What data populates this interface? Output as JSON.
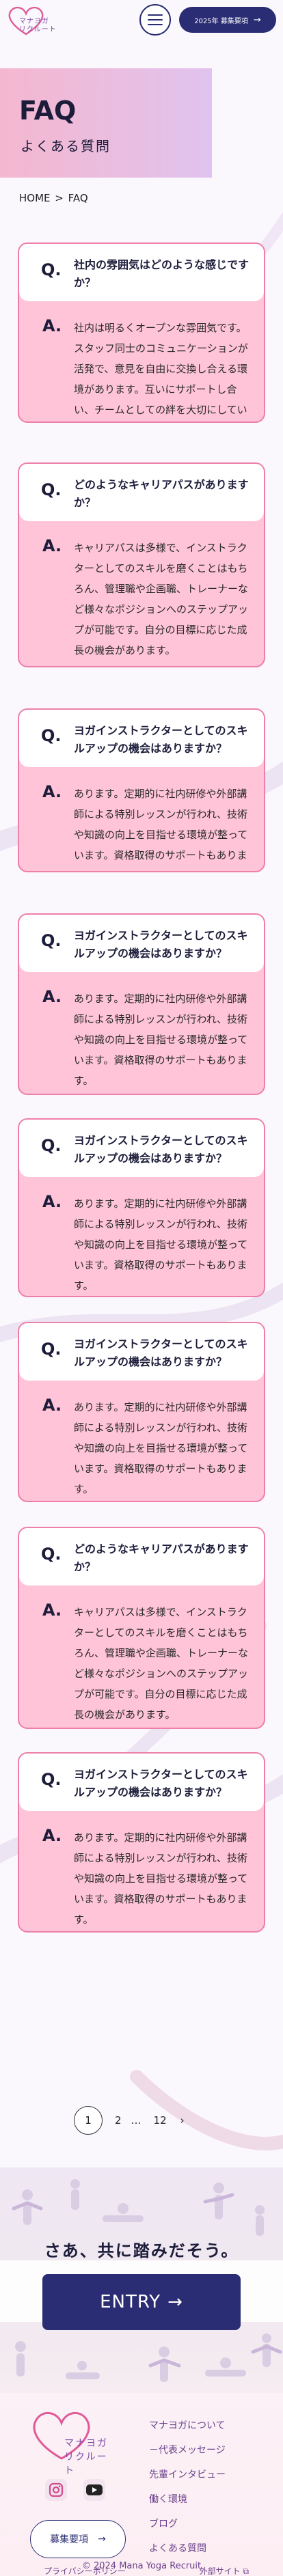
{
  "header": {
    "logo_text_line1": "マナヨガ",
    "logo_text_line2": "リクルート",
    "recruit_button_label": "2025年 募集要項",
    "menu_label": "menu-icon"
  },
  "hero": {
    "title": "FAQ",
    "subtitle": "よくある質問"
  },
  "breadcrumb": {
    "home": "HOME",
    "separator": ">",
    "current": "FAQ"
  },
  "faq": [
    {
      "q_mark": "Q.",
      "question": "社内の雰囲気はどのような感じですか？",
      "a_mark": "A.",
      "answer": "社内は明るくオープンな雰囲気です。スタッフ同士のコミュニケーションが活発で、意見を自由に交換し合える環境があります。互いにサポートし合い、チームとしての絆を大切にしています。"
    },
    {
      "q_mark": "Q.",
      "question": "どのようなキャリアパスがありますか？",
      "a_mark": "A.",
      "answer": "キャリアパスは多様で、インストラクターとしてのスキルを磨くことはもちろん、管理職や企画職、トレーナーなど様々なポジションへのステップアップが可能です。自分の目標に応じた成長の機会があります。"
    },
    {
      "q_mark": "Q.",
      "question": "ヨガインストラクターとしてのスキルアップの機会はありますか？",
      "a_mark": "A.",
      "answer": "あります。定期的に社内研修や外部講師による特別レッスンが行われ、技術や知識の向上を目指せる環境が整っています。資格取得のサポートもあります。"
    },
    {
      "q_mark": "Q.",
      "question": "ヨガインストラクターとしてのスキルアップの機会はありますか？",
      "a_mark": "A.",
      "answer": "あります。定期的に社内研修や外部講師による特別レッスンが行われ、技術や知識の向上を目指せる環境が整っています。資格取得のサポートもあります。"
    },
    {
      "q_mark": "Q.",
      "question": "ヨガインストラクターとしてのスキルアップの機会はありますか？",
      "a_mark": "A.",
      "answer": "あります。定期的に社内研修や外部講師による特別レッスンが行われ、技術や知識の向上を目指せる環境が整っています。資格取得のサポートもあります。"
    },
    {
      "q_mark": "Q.",
      "question": "ヨガインストラクターとしてのスキルアップの機会はありますか？",
      "a_mark": "A.",
      "answer": "あります。定期的に社内研修や外部講師による特別レッスンが行われ、技術や知識の向上を目指せる環境が整っています。資格取得のサポートもあります。"
    },
    {
      "q_mark": "Q.",
      "question": "どのようなキャリアパスがありますか？",
      "a_mark": "A.",
      "answer": "キャリアパスは多様で、インストラクターとしてのスキルを磨くことはもちろん、管理職や企画職、トレーナーなど様々なポジションへのステップアップが可能です。自分の目標に応じた成長の機会があります。"
    },
    {
      "q_mark": "Q.",
      "question": "ヨガインストラクターとしてのスキルアップの機会はありますか？",
      "a_mark": "A.",
      "answer": "あります。定期的に社内研修や外部講師による特別レッスンが行われ、技術や知識の向上を目指せる環境が整っています。資格取得のサポートもあります。"
    }
  ],
  "pagination": {
    "current": "1",
    "page2": "2",
    "dots": "…",
    "last": "12",
    "next": "›"
  },
  "entry": {
    "catch": "さあ、共に踏みだそう。",
    "button_label": "ENTRY",
    "button_arrow": "→"
  },
  "footer": {
    "logo_line1": "マナヨガ",
    "logo_line2": "リクルート",
    "nav": [
      "マナヨガについて",
      "－代表メッセージ",
      "先輩インタビュー",
      "働く環境",
      "ブログ",
      "よくある質問"
    ],
    "recruit_label": "募集要項",
    "recruit_arrow": "→",
    "privacy": "プライバシーポリシー",
    "external": "外部サイト",
    "copyright": "© 2024 Mana Yoga Recruit"
  },
  "colors": {
    "navy": "#2a2d73",
    "pink_card": "#ffc4d8",
    "pink_border": "#ee7fa8",
    "purple_text": "#6a3f8a"
  }
}
